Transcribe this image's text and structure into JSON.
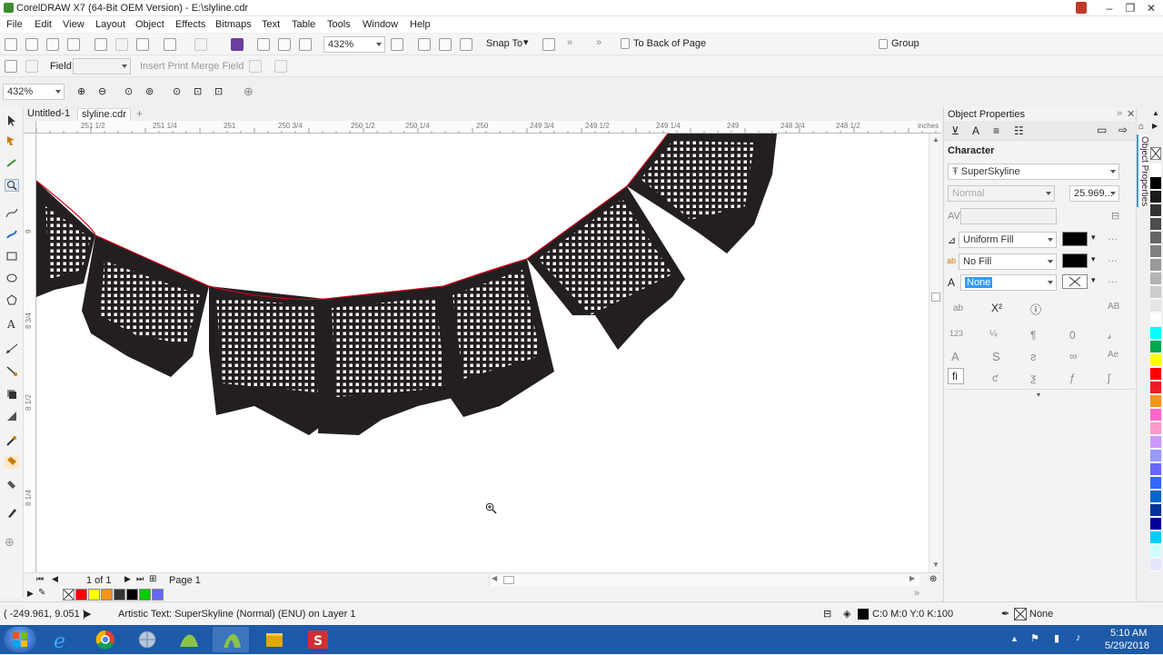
{
  "window": {
    "title": "CorelDRAW X7 (64-Bit OEM Version) - E:\\slyline.cdr"
  },
  "menu": [
    "File",
    "Edit",
    "View",
    "Layout",
    "Object",
    "Effects",
    "Bitmaps",
    "Text",
    "Table",
    "Tools",
    "Window",
    "Help"
  ],
  "standard_toolbar": {
    "zoom": "432%",
    "snap_to_label": "Snap To",
    "to_back_label": "To Back of Page",
    "group_label": "Group"
  },
  "merge_toolbar": {
    "field_label": "Field:",
    "insert_label": "Insert Print Merge Field"
  },
  "zoom_toolbar": {
    "zoom": "432%"
  },
  "document_tabs": [
    "Untitled-1",
    "slyline.cdr"
  ],
  "ruler": {
    "h_ticks": [
      "251 1/2",
      "251 1/4",
      "251",
      "250 3/4",
      "250 1/2",
      "250 1/4",
      "250",
      "249 3/4",
      "249 1/2",
      "249 1/4",
      "249",
      "248 3/4",
      "248 1/2"
    ],
    "unit": "inches",
    "v_ticks": [
      "9",
      "8 3/4",
      "8 1/2",
      "8 1/4"
    ]
  },
  "page_nav": {
    "page_count": "1 of 1",
    "page_tab": "Page 1"
  },
  "object_properties": {
    "title": "Object Properties",
    "section": "Character",
    "font": "SuperSkyline",
    "style": "Normal",
    "size": "25.969...",
    "fill_type": "Uniform Fill",
    "bg_fill_type": "No Fill",
    "outline": "None",
    "side_tab": "Object Properties"
  },
  "status": {
    "coords": "( -249.961, 9.051 )",
    "info": "Artistic Text: SuperSkyline (Normal) (ENU) on Layer 1",
    "fill_info": "C:0 M:0 Y:0 K:100",
    "outline_info": "None"
  },
  "taskbar": {
    "time": "5:10 AM",
    "date": "5/29/2018"
  },
  "colors": {
    "accent": "#1d5aa8",
    "skyline": "#231f20",
    "path": "#d0021b",
    "palette": [
      "#ffffff",
      "#000000",
      "#1a1a1a",
      "#333333",
      "#4d4d4d",
      "#666666",
      "#808080",
      "#999999",
      "#b3b3b3",
      "#cccccc",
      "#e6e6e6",
      "#ffffff",
      "#00ffff",
      "#00a651",
      "#ffff00",
      "#ff0000",
      "#ed1c24",
      "#f7941d",
      "#ff66cc",
      "#ff99cc",
      "#cc99ff",
      "#9999ff",
      "#6666ff",
      "#3366ff",
      "#0066cc",
      "#003399",
      "#000099",
      "#00ccff",
      "#ccffff",
      "#e6e6ff"
    ],
    "quick_swatches": [
      "#ff0000",
      "#ffff00",
      "#f7941d",
      "#333333",
      "#000000",
      "#00cc00",
      "#6666ff"
    ]
  }
}
